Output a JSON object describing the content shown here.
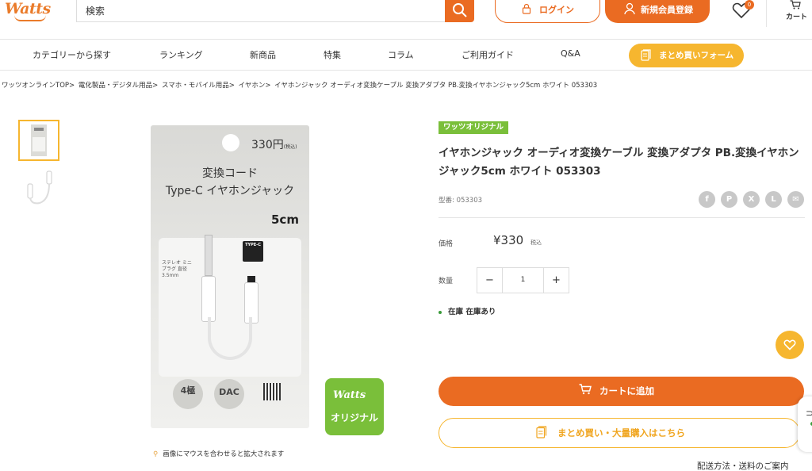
{
  "brand": {
    "logo_text": "Watts",
    "accent": "#ea6b22",
    "yellow": "#f6b62f",
    "green": "#7abf3a"
  },
  "header": {
    "search_placeholder": "検索",
    "login_label": "ログイン",
    "register_label": "新規会員登録",
    "favorites_count": "0",
    "cart_label": "カート"
  },
  "nav": {
    "items": [
      {
        "label": "カテゴリーから探す"
      },
      {
        "label": "ランキング"
      },
      {
        "label": "新商品"
      },
      {
        "label": "特集"
      },
      {
        "label": "コラム"
      },
      {
        "label": "ご利用ガイド"
      },
      {
        "label": "Q&A"
      }
    ],
    "bulk_form_label": "まとめ買いフォーム"
  },
  "breadcrumb": [
    "ワッツオンラインTOP>",
    "電化製品・デジタル用品>",
    "スマホ・モバイル用品>",
    "イヤホン>",
    "イヤホンジャック オーディオ変換ケーブル 変換アダプタ PB.変換イヤホンジャック5cm ホワイト 053303"
  ],
  "gallery": {
    "zoom_hint": "画像にマウスを合わせると拡大されます",
    "package": {
      "price": "330円",
      "price_tax_note": "(税込)",
      "title_line1": "変換コード",
      "title_line2": "Type-C イヤホンジャック",
      "length": "5cm",
      "typec_badge": "TYPE-C",
      "plug_note": "ステレオ ミニプラグ 直径3.5mm",
      "badge_pole": "4極",
      "badge_dac": "DAC"
    },
    "original_badge": {
      "logo": "Watts",
      "label": "オリジナル"
    }
  },
  "product": {
    "tag": "ワッツオリジナル",
    "title": "イヤホンジャック オーディオ変換ケーブル 変換アダプタ PB.変換イヤホンジャック5cm ホワイト 053303",
    "model": "型番: 053303",
    "share_icons": [
      "f",
      "P",
      "X",
      "L",
      "✉"
    ],
    "price_label": "価格",
    "price_value": "¥330",
    "price_tax": "税込",
    "qty_label": "数量",
    "qty_value": "1",
    "qty_minus": "−",
    "qty_plus": "+",
    "stock_label": "在庫",
    "stock_value": "在庫あり",
    "add_to_cart_label": "カートに追加",
    "bulk_buy_label": "まとめ買い・大量購入はこちら",
    "shipping_link": "配送方法・送料のご案内"
  }
}
